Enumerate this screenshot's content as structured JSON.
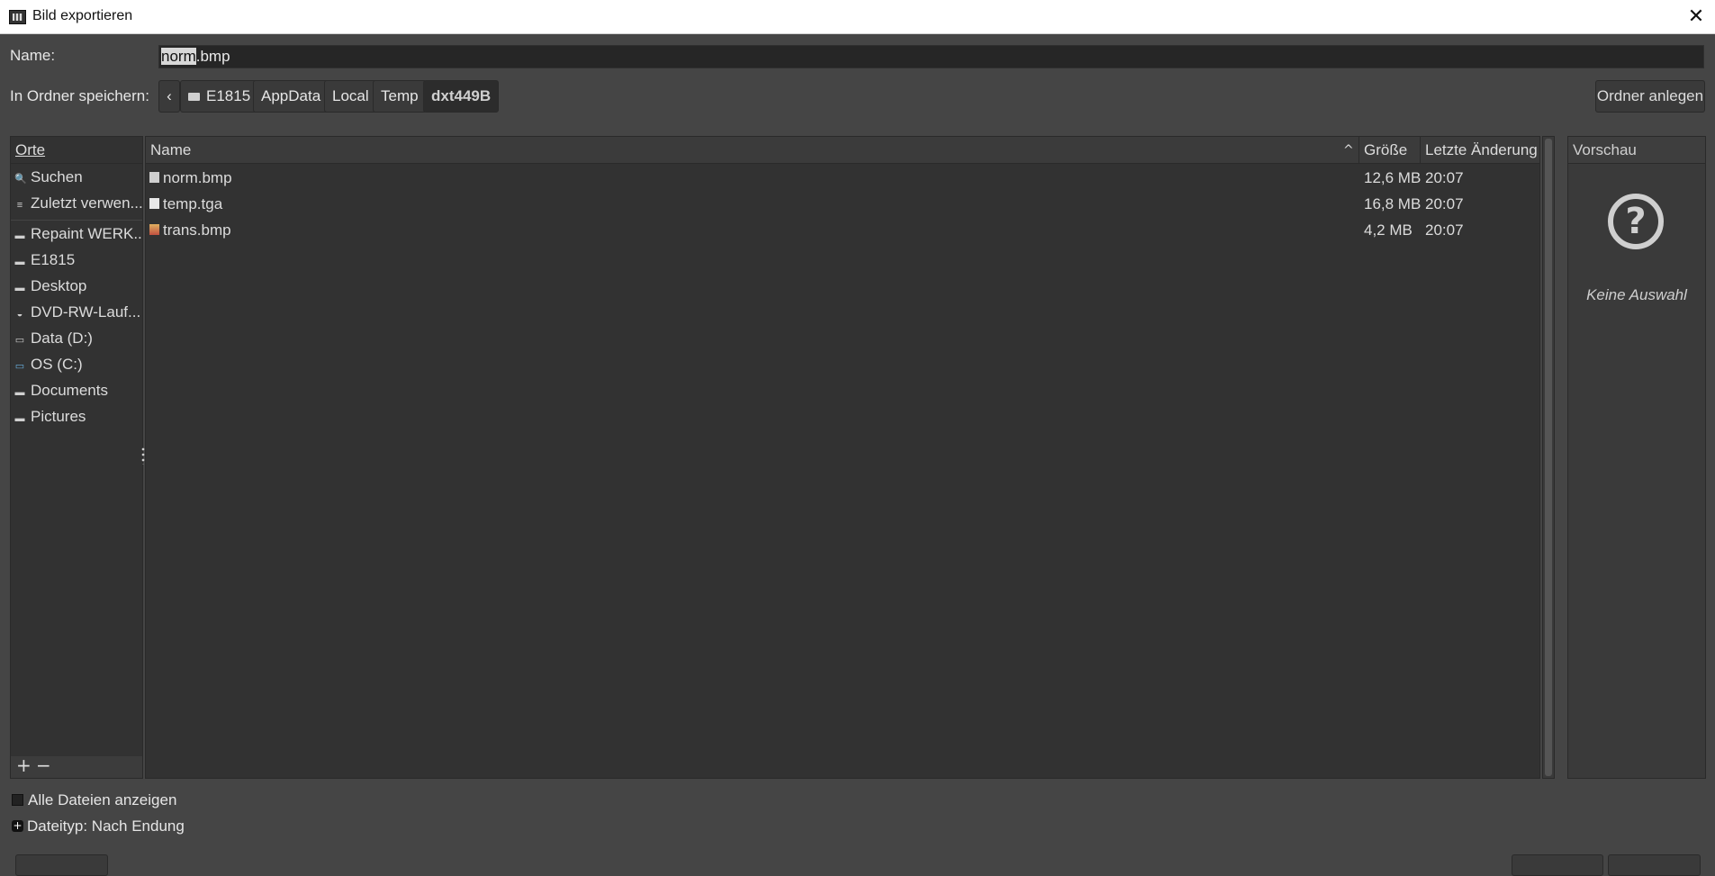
{
  "window": {
    "title": "Bild exportieren",
    "close_glyph": "✕"
  },
  "name_row": {
    "label": "Name:",
    "value_selected": "norm",
    "value_rest": ".bmp"
  },
  "folder_row": {
    "label": "In Ordner speichern:",
    "back_glyph": "‹",
    "crumbs": [
      "E1815",
      "AppData",
      "Local",
      "Temp",
      "dxt449B"
    ],
    "new_folder": "Ordner anlegen"
  },
  "places": {
    "header": "Orte",
    "items": [
      {
        "label": "Suchen",
        "icon": "search-icon",
        "glyph": "🔍"
      },
      {
        "label": "Zuletzt verwen...",
        "icon": "recent-icon",
        "glyph": "≡"
      },
      {
        "label": "Repaint WERK...",
        "icon": "folder-icon",
        "glyph": "▬"
      },
      {
        "label": "E1815",
        "icon": "folder-icon",
        "glyph": "▬"
      },
      {
        "label": "Desktop",
        "icon": "folder-icon",
        "glyph": "▬"
      },
      {
        "label": "DVD-RW-Lauf...",
        "icon": "optical-drive-icon",
        "glyph": "◒"
      },
      {
        "label": "Data (D:)",
        "icon": "drive-icon",
        "glyph": "▭"
      },
      {
        "label": "OS (C:)",
        "icon": "system-drive-icon",
        "glyph": "▭"
      },
      {
        "label": "Documents",
        "icon": "folder-icon",
        "glyph": "▬"
      },
      {
        "label": "Pictures",
        "icon": "folder-icon",
        "glyph": "▬"
      }
    ],
    "add": "+",
    "remove": "−"
  },
  "files": {
    "columns": {
      "name": "Name",
      "size": "Größe",
      "modified": "Letzte Änderung"
    },
    "sort_glyph": "^",
    "rows": [
      {
        "name": "norm.bmp",
        "size": "12,6 MB",
        "modified": "20:07",
        "icon": "image-file-icon"
      },
      {
        "name": "temp.tga",
        "size": "16,8 MB",
        "modified": "20:07",
        "icon": "file-icon"
      },
      {
        "name": "trans.bmp",
        "size": "4,2 MB",
        "modified": "20:07",
        "icon": "image-file-icon"
      }
    ]
  },
  "preview": {
    "header": "Vorschau",
    "glyph": "?",
    "empty_text": "Keine Auswahl"
  },
  "options": {
    "show_all": "Alle Dateien anzeigen",
    "file_type": "Dateityp: Nach Endung",
    "type_glyph": "+"
  }
}
